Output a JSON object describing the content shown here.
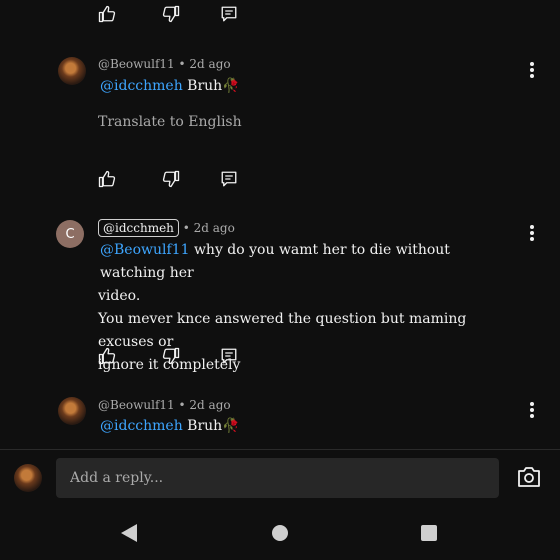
{
  "comments": [
    {
      "author": "@Beowulf11",
      "time": "• 2d ago",
      "mention": "@idcchmeh",
      "text": "Bruh🥀",
      "translate": "Translate to English",
      "avatar_icon": "profile-photo"
    },
    {
      "author": "@idcchmeh",
      "time": "• 2d ago",
      "avatar_letter": "C",
      "mention": "@Beowulf11",
      "text_line1": "why do you wamt her to die without watching her",
      "text_line2": "video.",
      "text_line3": "You mever knce answered the question but maming excuses or",
      "text_line4": "ignore it completely"
    },
    {
      "author": "@Beowulf11",
      "time": "• 2d ago",
      "mention": "@idcchmeh",
      "text": "Bruh🥀",
      "avatar_icon": "profile-photo"
    }
  ],
  "reply": {
    "placeholder": "Add a reply..."
  },
  "icons": {
    "like": "thumb-up-icon",
    "dislike": "thumb-down-icon",
    "reply": "reply-icon",
    "more": "more-vert-icon",
    "camera": "camera-icon",
    "back": "back-triangle-icon",
    "home": "home-circle-icon",
    "recents": "recents-square-icon"
  },
  "colors": {
    "background": "#0f0f0f",
    "mention": "#3ea6ff",
    "input": "#272727"
  }
}
